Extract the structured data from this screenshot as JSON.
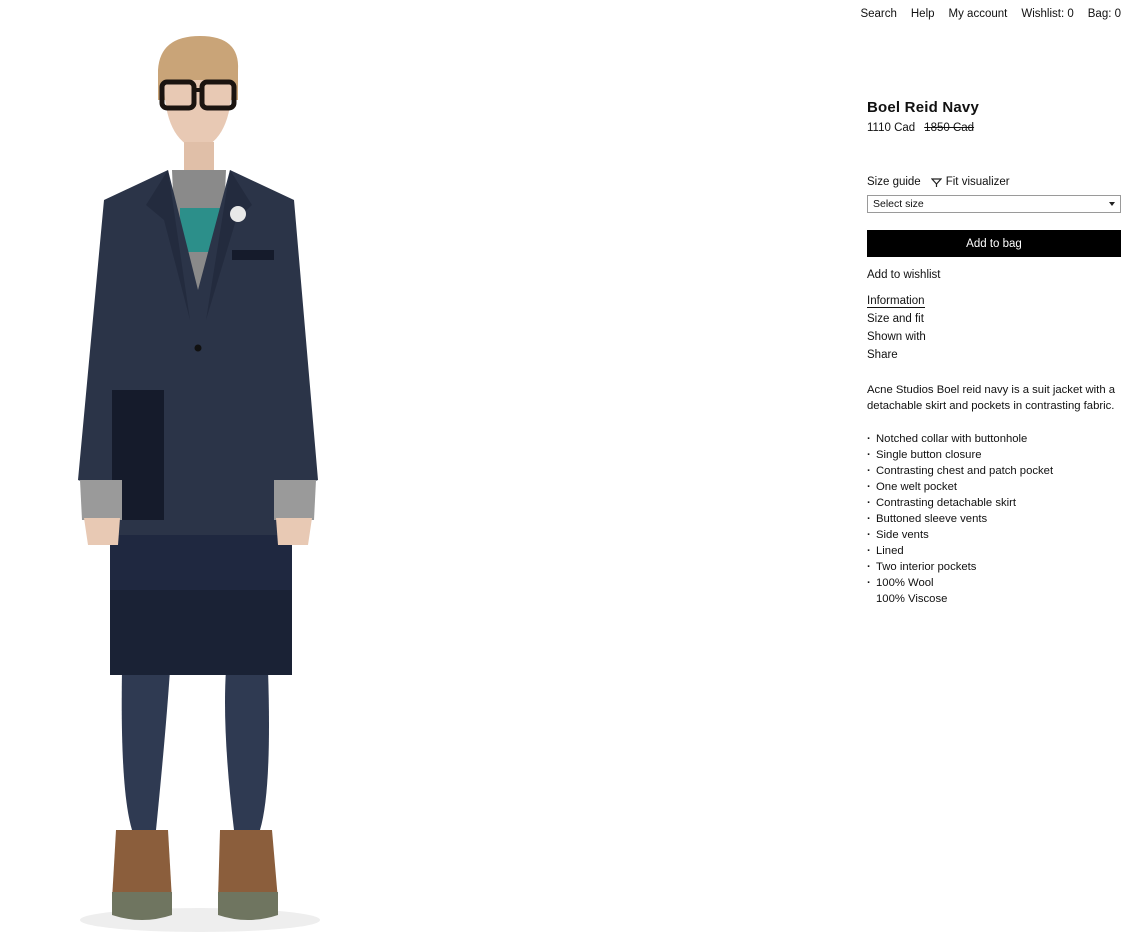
{
  "nav": {
    "search": "Search",
    "help": "Help",
    "account": "My account",
    "wishlist": "Wishlist: 0",
    "bag": "Bag: 0"
  },
  "product": {
    "title": "Boel Reid Navy",
    "price": "1110 Cad",
    "old_price": "1850 Cad",
    "image_icon": "product-model-photo"
  },
  "size": {
    "guide_label": "Size guide",
    "fit_label": "Fit visualizer",
    "fit_icon": "hanger-icon",
    "select_value": "Select size"
  },
  "actions": {
    "add_to_bag": "Add to bag",
    "add_to_wishlist": "Add to wishlist"
  },
  "tabs": [
    {
      "label": "Information",
      "active": true
    },
    {
      "label": "Size and fit"
    },
    {
      "label": "Shown with"
    },
    {
      "label": "Share"
    }
  ],
  "description": "Acne Studios Boel reid navy is a suit jacket with a detachable skirt and pockets in contrasting fabric.",
  "features": [
    "Notched collar with buttonhole",
    "Single button closure",
    "Contrasting chest and patch pocket",
    "One welt pocket",
    "Contrasting detachable skirt",
    "Buttoned sleeve vents",
    "Side vents",
    "Lined",
    "Two interior pockets",
    "100% Wool",
    "100% Viscose"
  ],
  "colors": {
    "navy": "#2b3448",
    "button_bg": "#000000"
  }
}
